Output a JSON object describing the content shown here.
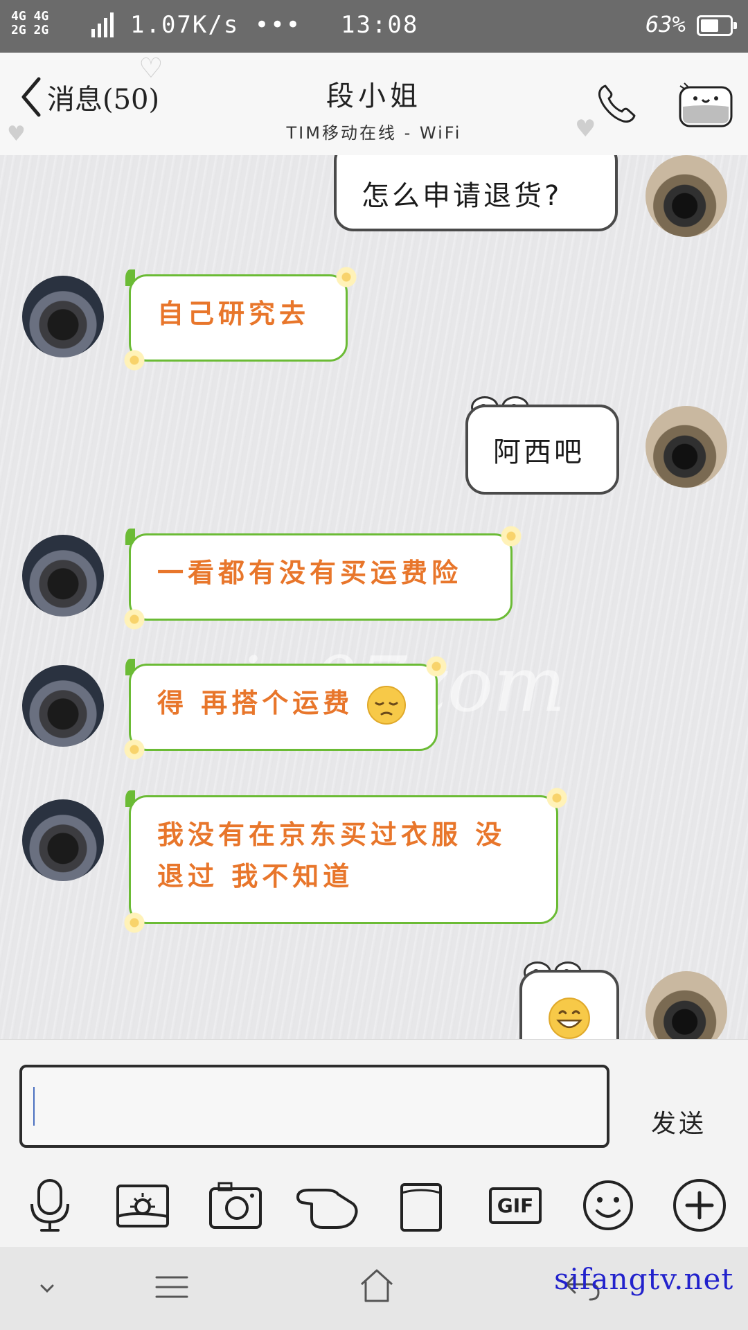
{
  "status_bar": {
    "network_top": "4G 4G",
    "network_bottom": "2G 2G",
    "network_small": "2G",
    "speed": "1.07K/s •••",
    "time": "13:08",
    "battery_pct": "63%",
    "battery_level": 0.63
  },
  "header": {
    "back_label": "消息(50)",
    "contact_name": "段小姐",
    "presence": "TIM移动在线 - WiFi"
  },
  "chat": {
    "messages": [
      {
        "side": "right",
        "text": "怎么申请退货?"
      },
      {
        "side": "left",
        "text": "自己研究去"
      },
      {
        "side": "right",
        "text": "阿西吧"
      },
      {
        "side": "left",
        "text": "一看都有没有买运费险"
      },
      {
        "side": "left",
        "text": "得 再搭个运费",
        "emoji": "pensive-face"
      },
      {
        "side": "left",
        "text_line1": "我没有在京东买过衣服 没",
        "text_line2": "退过 我不知道"
      },
      {
        "side": "right",
        "emoji": "grinning-face"
      }
    ],
    "watermark": "yin07zom"
  },
  "input": {
    "value": "",
    "send_label": "发送"
  },
  "toolbar": {
    "icons": [
      "microphone-icon",
      "image-icon",
      "camera-icon",
      "poke-hand-icon",
      "file-icon",
      "gif-icon",
      "emoji-icon",
      "plus-icon"
    ],
    "gif_label": "GIF"
  },
  "navbar": {
    "icons": [
      "collapse-icon",
      "menu-icon",
      "home-icon",
      "back-icon"
    ]
  },
  "site_watermark": "sifangtv.net",
  "colors": {
    "status_bar": "#6b6b6b",
    "incoming_text": "#e8762b",
    "incoming_border": "#6bbb35",
    "outgoing_border": "#4a4a4a",
    "watermark_link": "#2222cc"
  }
}
